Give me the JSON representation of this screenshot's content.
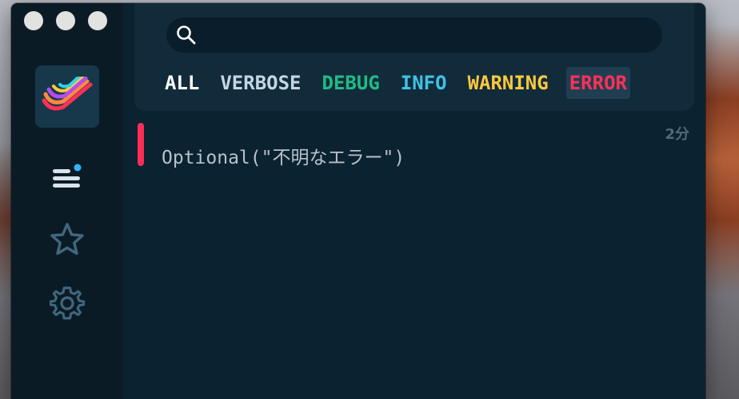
{
  "sidebar": {
    "logo_icon": "rainbow-streak-logo",
    "items": [
      {
        "name": "logs",
        "icon": "list-lines-icon",
        "active": true
      },
      {
        "name": "favorites",
        "icon": "star-icon"
      },
      {
        "name": "settings",
        "icon": "gear-icon"
      }
    ]
  },
  "search": {
    "value": "",
    "placeholder": ""
  },
  "levels": [
    {
      "label": "ALL",
      "color": "#ffffff"
    },
    {
      "label": "VERBOSE",
      "color": "#c5d6e2"
    },
    {
      "label": "DEBUG",
      "color": "#1fbd85"
    },
    {
      "label": "INFO",
      "color": "#3fc3e6"
    },
    {
      "label": "WARNING",
      "color": "#ffc93c"
    },
    {
      "label": "ERROR",
      "color": "#ff3158",
      "selected": true
    }
  ],
  "log": {
    "entries": [
      {
        "level": "ERROR",
        "message": "Optional(\"不明なエラー\")",
        "time": "2分",
        "level_color": "#ff2e56"
      }
    ]
  },
  "colors": {
    "sidebar_bg": "#0b1b26",
    "main_bg": "#0b2230",
    "panel_bg": "#112b3b",
    "accent_dot": "#2fb6ff"
  }
}
